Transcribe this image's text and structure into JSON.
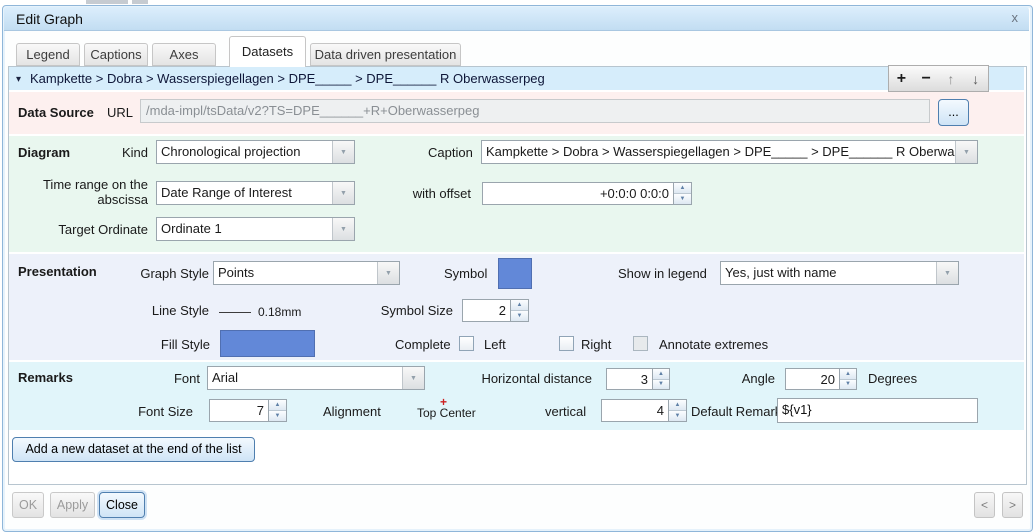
{
  "window": {
    "title": "Edit Graph"
  },
  "icons": {
    "close": "x",
    "expand": "▾",
    "add": "+",
    "remove": "−",
    "move_up": "↑",
    "move_down": "↓",
    "spin_up": "▲",
    "spin_down": "▼",
    "combo_arrow": "▼",
    "prev": "<",
    "next": ">",
    "alignment_marker": "+"
  },
  "tabs": [
    {
      "label": "Legend",
      "active": false
    },
    {
      "label": "Captions",
      "active": false
    },
    {
      "label": "Axes",
      "active": false
    },
    {
      "label": "Datasets",
      "active": true
    },
    {
      "label": "Data driven presentation",
      "active": false
    }
  ],
  "dataset_header": {
    "breadcrumb": "Kampkette > Dobra > Wasserspiegellagen > DPE_____ > DPE______ R Oberwasserpeg"
  },
  "data_source": {
    "title": "Data Source",
    "url_label": "URL",
    "url_value": "/mda-impl/tsData/v2?TS=DPE______+R+Oberwasserpeg",
    "browse": "..."
  },
  "diagram": {
    "title": "Diagram",
    "kind_label": "Kind",
    "kind_value": "Chronological projection",
    "caption_label": "Caption",
    "caption_value": "Kampkette > Dobra > Wasserspiegellagen > DPE_____ > DPE______ R Oberwas",
    "time_range_label": "Time range on the abscissa",
    "time_range_value": "Date Range of Interest",
    "offset_label": "with offset",
    "offset_value": "+0:0:0 0:0:0",
    "ordinate_label": "Target Ordinate",
    "ordinate_value": "Ordinate 1"
  },
  "presentation": {
    "title": "Presentation",
    "graph_style_label": "Graph Style",
    "graph_style_value": "Points",
    "symbol_label": "Symbol",
    "legend_label": "Show in legend",
    "legend_value": "Yes, just with name",
    "line_style_label": "Line Style",
    "line_style_value": "0.18mm",
    "symbol_size_label": "Symbol Size",
    "symbol_size_value": "2",
    "fill_style_label": "Fill Style",
    "complete_label": "Complete",
    "left_label": "Left",
    "right_label": "Right",
    "annotate_label": "Annotate extremes"
  },
  "remarks": {
    "title": "Remarks",
    "font_label": "Font",
    "font_value": "Arial",
    "horizontal_label": "Horizontal distance",
    "horizontal_value": "3",
    "angle_label": "Angle",
    "angle_value": "20",
    "degrees_label": "Degrees",
    "font_size_label": "Font Size",
    "font_size_value": "7",
    "alignment_label": "Alignment",
    "alignment_value": "Top Center",
    "vertical_label": "vertical",
    "vertical_value": "4",
    "default_remark_label": "Default Remark",
    "default_remark_value": "${v1}"
  },
  "buttons": {
    "add_dataset": "Add a new dataset at the end of the list",
    "ok": "OK",
    "apply": "Apply",
    "close": "Close"
  },
  "colors": {
    "symbol_swatch": "#6288d8",
    "fill_swatch": "#6288d8",
    "section_data_source": "#fdf0ef",
    "section_diagram": "#e9f7ef",
    "section_presentation": "#edf1fa",
    "section_remarks": "#e1f5fa",
    "header_bg": "#d6edfb"
  }
}
